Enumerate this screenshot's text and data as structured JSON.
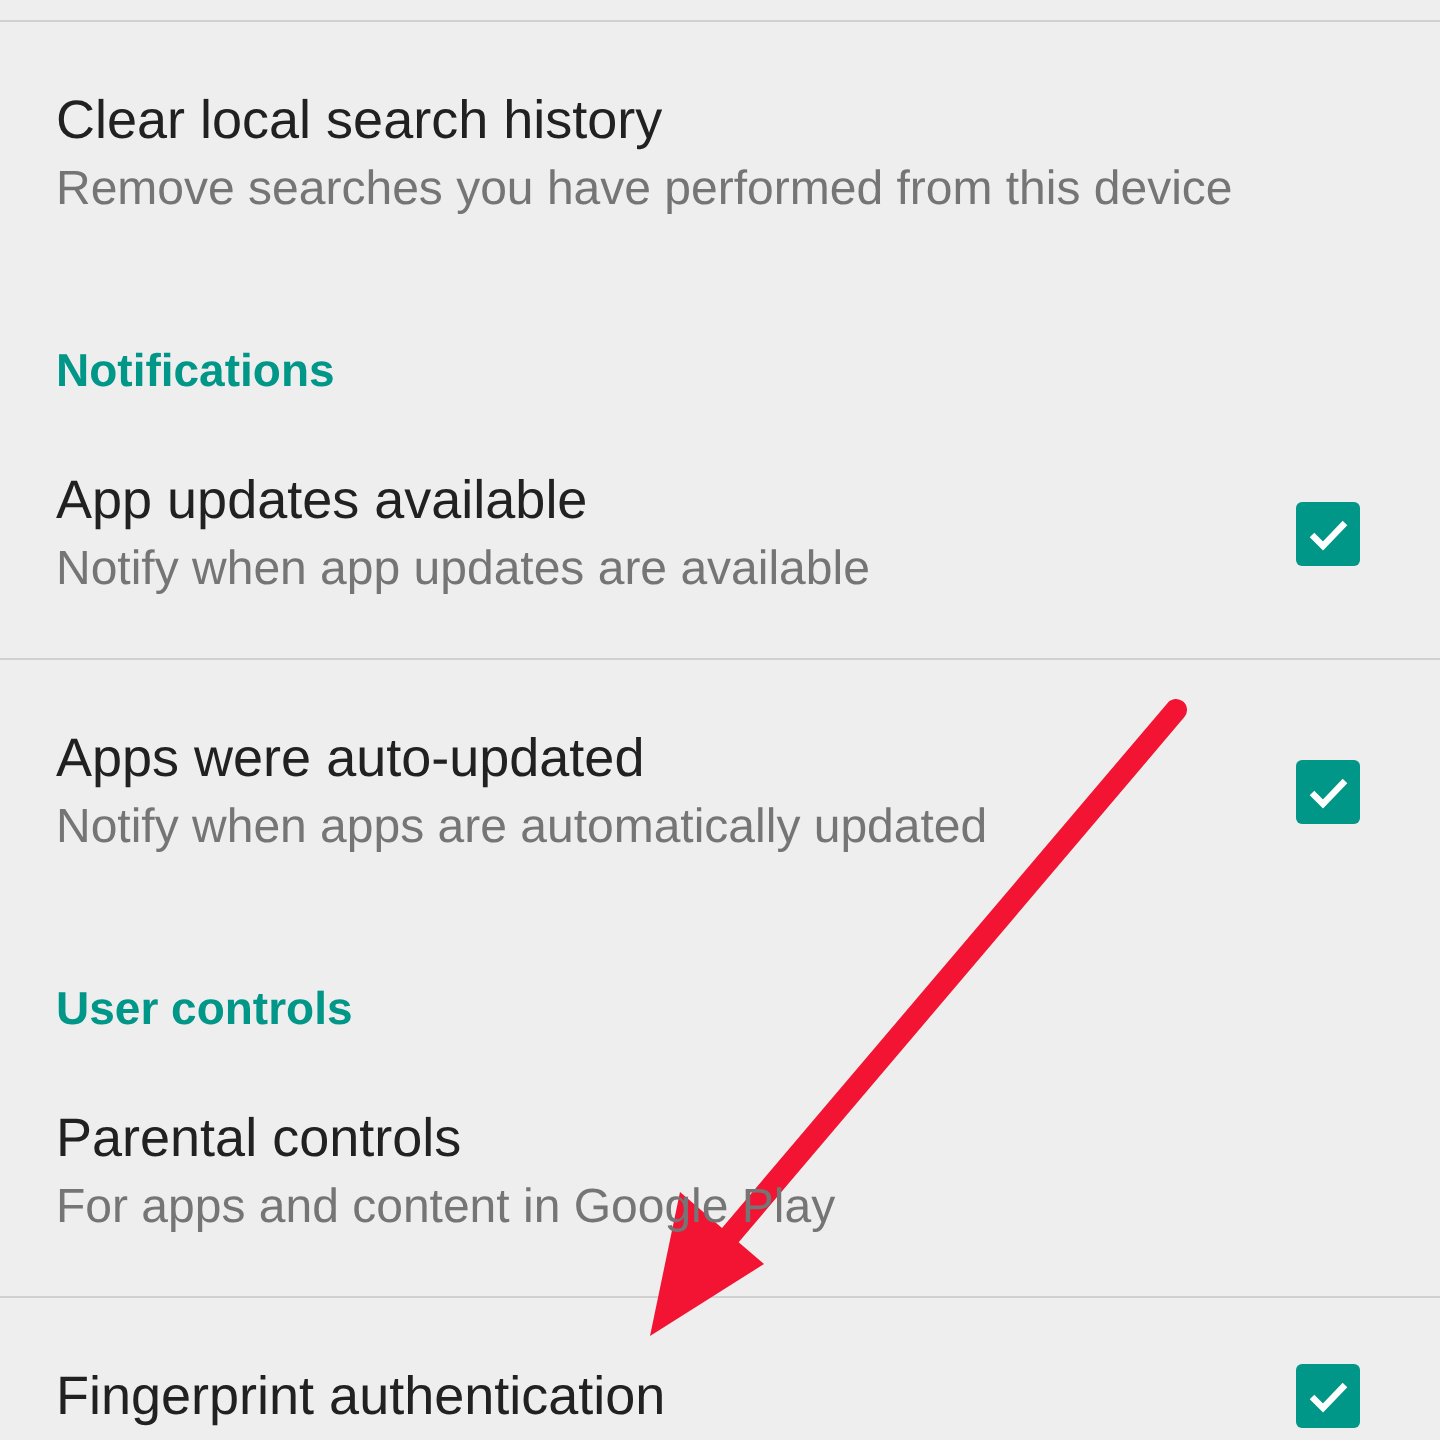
{
  "rows": [
    {
      "kind": "setting",
      "title": "Clear local search history",
      "subtitle": "Remove searches you have performed from this device"
    },
    {
      "kind": "header",
      "title": "Notifications"
    },
    {
      "kind": "toggle",
      "title": "App updates available",
      "subtitle": "Notify when app updates are available",
      "checked": true
    },
    {
      "kind": "toggle",
      "title": "Apps were auto-updated",
      "subtitle": "Notify when apps are automatically updated",
      "checked": true
    },
    {
      "kind": "header",
      "title": "User controls"
    },
    {
      "kind": "setting",
      "title": "Parental controls",
      "subtitle": "For apps and content in Google Play"
    },
    {
      "kind": "toggle",
      "title": "Fingerprint authentication",
      "checked": true
    }
  ]
}
